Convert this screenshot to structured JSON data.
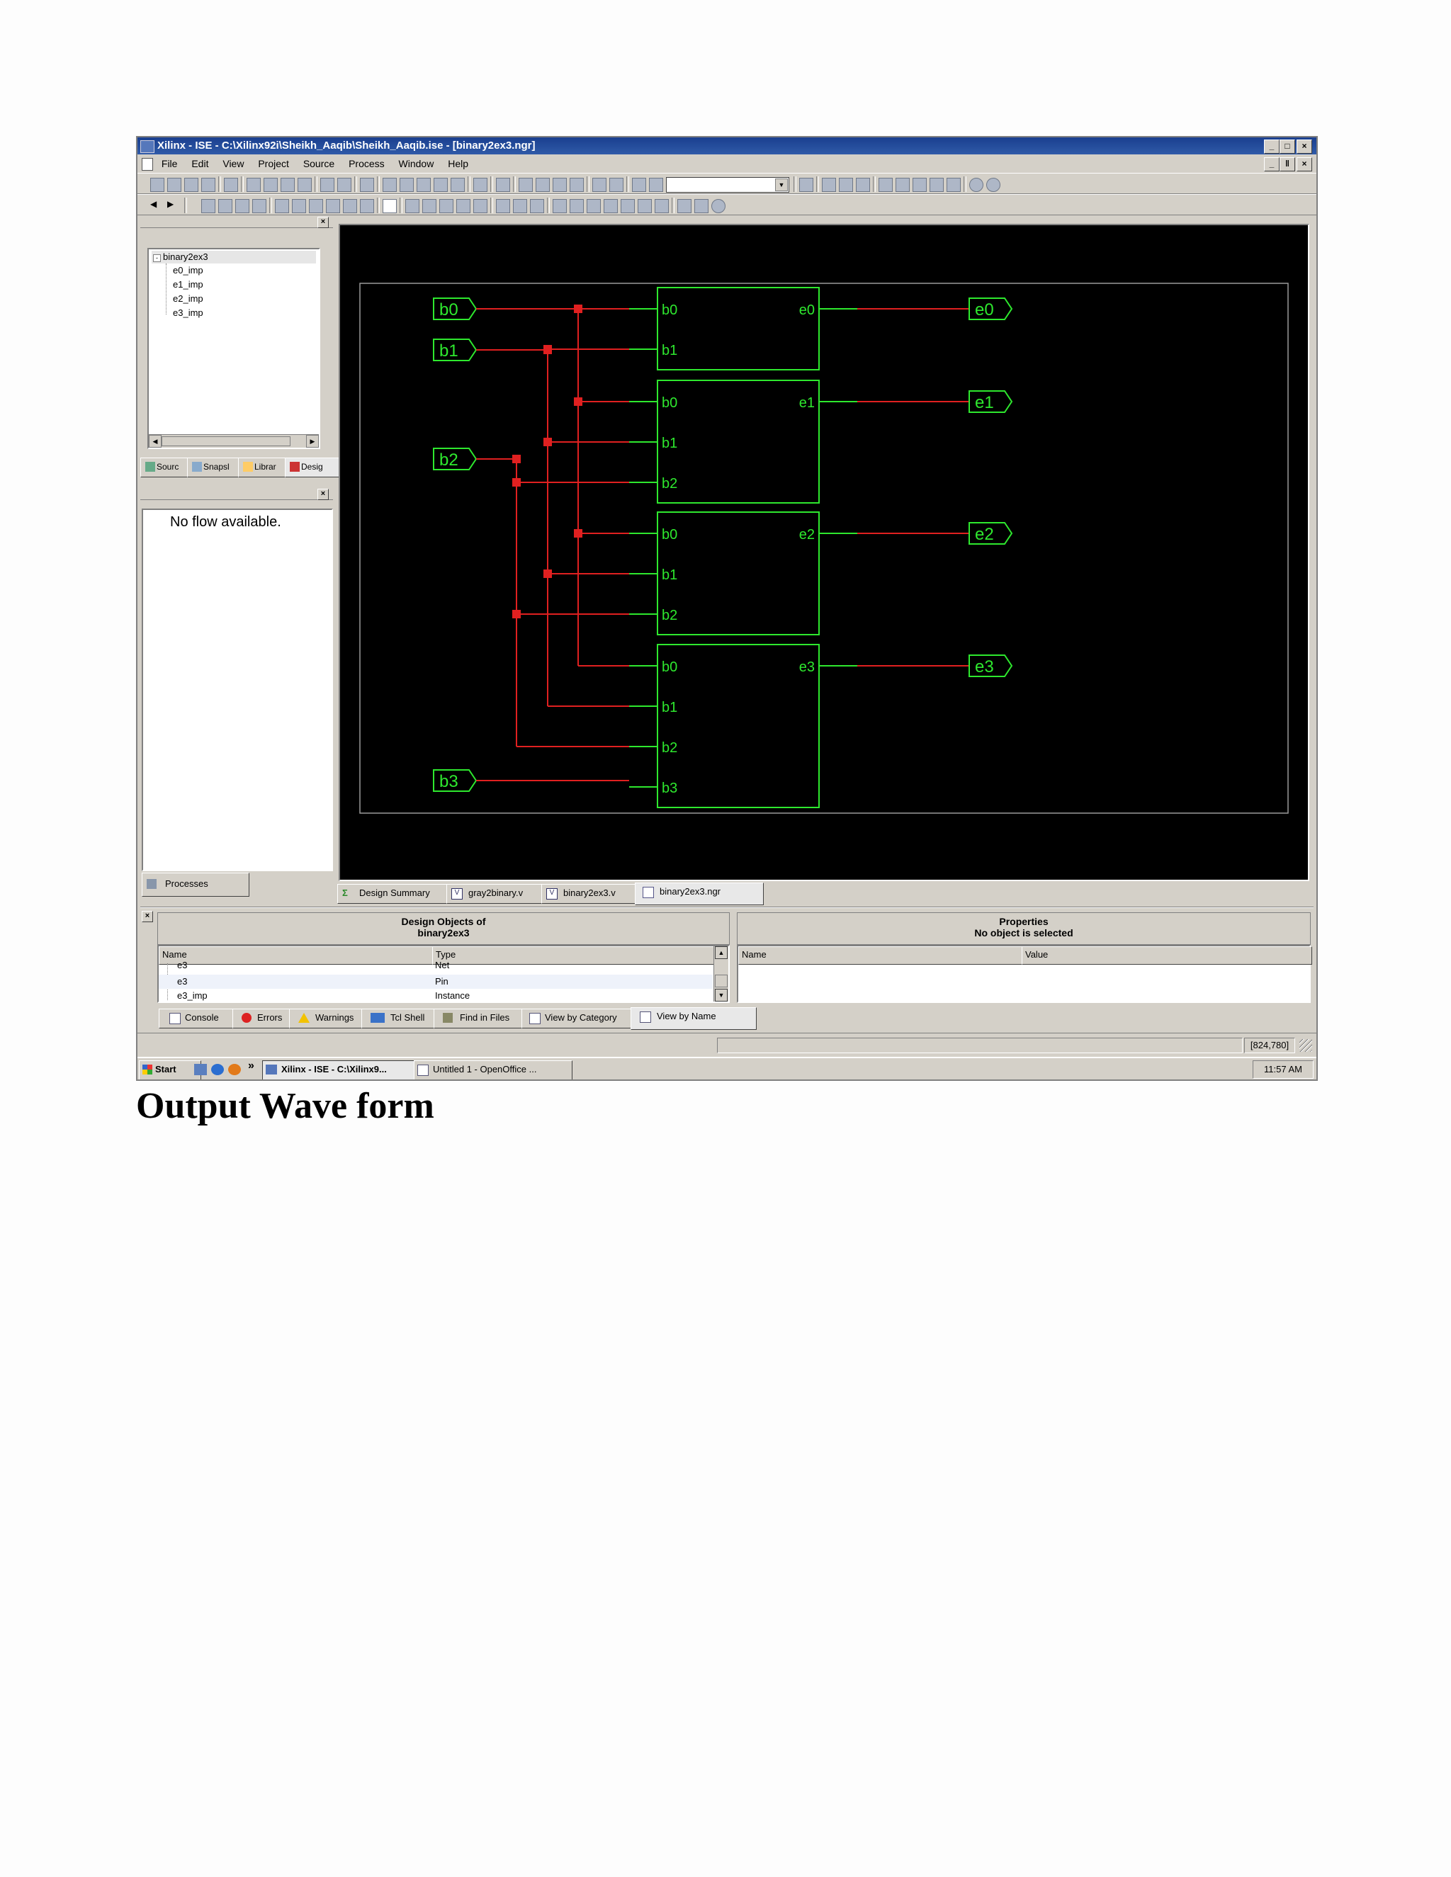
{
  "window": {
    "title": "Xilinx - ISE - C:\\Xilinx92i\\Sheikh_Aaqib\\Sheikh_Aaqib.ise - [binary2ex3.ngr]",
    "min": "_",
    "max": "□",
    "close": "×",
    "doc_restore": "ǁ"
  },
  "menu": [
    "File",
    "Edit",
    "View",
    "Project",
    "Source",
    "Process",
    "Window",
    "Help"
  ],
  "sources": {
    "root": "binary2ex3",
    "items": [
      "e0_imp",
      "e1_imp",
      "e2_imp",
      "e3_imp"
    ],
    "tabs": [
      "Sourc",
      "Snapsl",
      "Librar",
      "Desig"
    ]
  },
  "process": {
    "message": "No flow available.",
    "tab": "Processes"
  },
  "schematic": {
    "inputs": [
      "b0",
      "b1",
      "b2",
      "b3"
    ],
    "outputs": [
      "e0",
      "e1",
      "e2",
      "e3"
    ],
    "blocks": [
      {
        "inputs": [
          "b0",
          "b1"
        ],
        "output": "e0"
      },
      {
        "inputs": [
          "b0",
          "b1",
          "b2"
        ],
        "output": "e1"
      },
      {
        "inputs": [
          "b0",
          "b1",
          "b2"
        ],
        "output": "e2"
      },
      {
        "inputs": [
          "b0",
          "b1",
          "b2",
          "b3"
        ],
        "output": "e3"
      }
    ],
    "colors": {
      "wire_green": "#2ee82e",
      "wire_red": "#e02020",
      "background": "#000000"
    }
  },
  "doc_tabs": [
    "Design Summary",
    "gray2binary.v",
    "binary2ex3.v",
    "binary2ex3.ngr"
  ],
  "design_objects": {
    "title_line1": "Design Objects of",
    "title_line2": "binary2ex3",
    "columns": [
      "Name",
      "Type"
    ],
    "rows": [
      {
        "name": "e3",
        "type": "Net"
      },
      {
        "name": "e3",
        "type": "Pin"
      },
      {
        "name": "e3_imp",
        "type": "Instance"
      }
    ]
  },
  "properties": {
    "title_line1": "Properties",
    "title_line2": "No object is selected",
    "columns": [
      "Name",
      "Value"
    ]
  },
  "bottom_tabs": [
    "Console",
    "Errors",
    "Warnings",
    "Tcl Shell",
    "Find in Files",
    "View by Category",
    "View by Name"
  ],
  "status": {
    "coords": "[824,780]"
  },
  "taskbar": {
    "start": "Start",
    "chevron": "»",
    "buttons": [
      "Xilinx - ISE - C:\\Xilinx9...",
      "Untitled 1 - OpenOffice ..."
    ],
    "clock": "11:57 AM"
  },
  "heading": "Output Wave form"
}
